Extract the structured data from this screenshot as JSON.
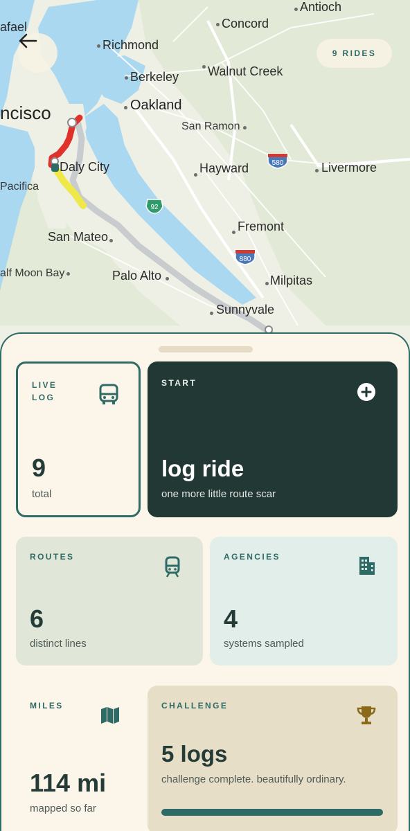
{
  "header": {
    "back_icon": "arrow-left-icon",
    "rides_badge": "9 RIDES"
  },
  "map": {
    "labels": {
      "antioch": "Antioch",
      "rafael": "afael",
      "concord": "Concord",
      "richmond": "Richmond",
      "berkeley": "Berkeley",
      "walnut_creek": "Walnut Creek",
      "san_francisco": "ncisco",
      "oakland": "Oakland",
      "san_ramon": "San Ramon",
      "daly_city": "Daly City",
      "hayward": "Hayward",
      "livermore": "Livermore",
      "pacifica": "Pacifica",
      "fremont": "Fremont",
      "san_mateo": "San Mateo",
      "half_moon_bay": "alf Moon Bay",
      "palo_alto": "Palo Alto",
      "milpitas": "Milpitas",
      "sunnyvale": "Sunnyvale"
    },
    "shields": {
      "i580": "580",
      "r92": "92",
      "i880": "880"
    },
    "colors": {
      "water": "#a9d8f0",
      "land": "#eef0e6",
      "route_red": "#e0322a",
      "route_yellow": "#eee84a",
      "route_grey": "#c9ccce"
    }
  },
  "cards": {
    "live": {
      "label": "LIVE\nLOG",
      "icon": "bus-icon",
      "value": "9",
      "sub": "total"
    },
    "start": {
      "label": "START",
      "icon": "plus-circle-icon",
      "value": "log ride",
      "sub": "one more little route scar"
    },
    "routes": {
      "label": "ROUTES",
      "icon": "train-icon",
      "value": "6",
      "sub": "distinct lines"
    },
    "agencies": {
      "label": "AGENCIES",
      "icon": "building-icon",
      "value": "4",
      "sub": "systems sampled"
    },
    "miles": {
      "label": "MILES",
      "icon": "map-icon",
      "value": "114 mi",
      "sub": "mapped so far"
    },
    "challenge": {
      "label": "CHALLENGE",
      "icon": "trophy-icon",
      "value": "5 logs",
      "sub": "challenge complete. beautifully ordinary.",
      "progress": 1.0
    }
  },
  "colors": {
    "accent": "#2f6b66",
    "dark_card": "#223835",
    "background": "#fcf6ea"
  }
}
